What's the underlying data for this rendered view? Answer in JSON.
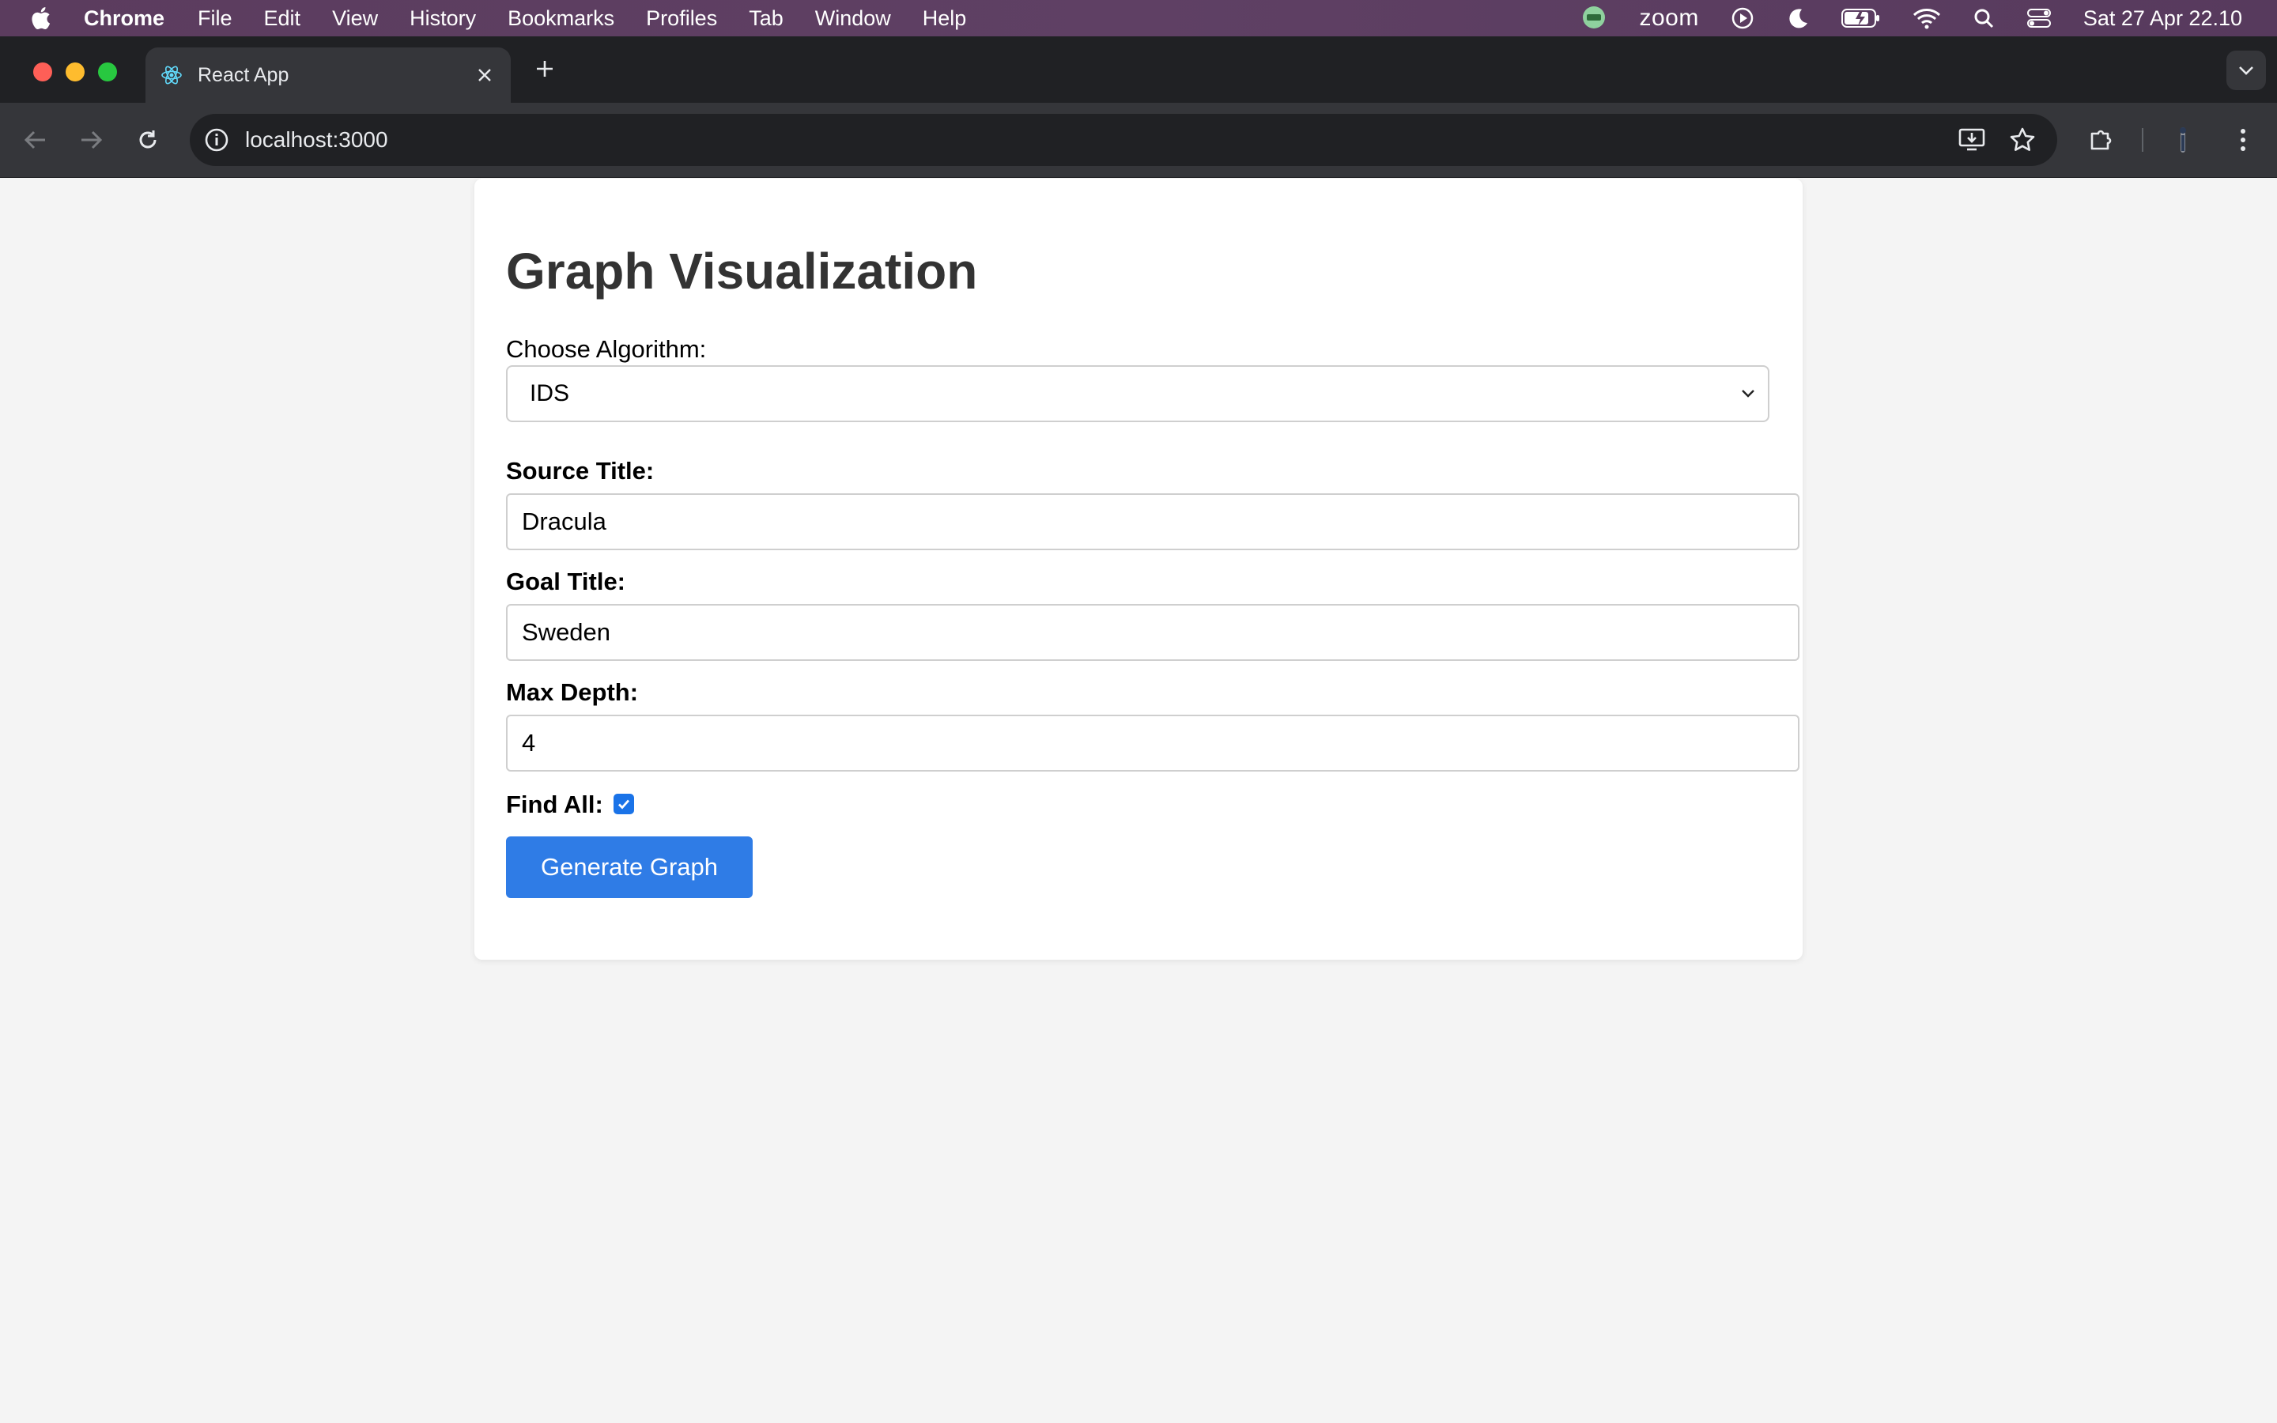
{
  "menubar": {
    "app_name": "Chrome",
    "menus": [
      "File",
      "Edit",
      "View",
      "History",
      "Bookmarks",
      "Profiles",
      "Tab",
      "Window",
      "Help"
    ],
    "zoom_label": "zoom",
    "clock": "Sat 27 Apr  22.10"
  },
  "browser": {
    "tab_title": "React App",
    "url": "localhost:3000"
  },
  "page": {
    "heading": "Graph Visualization",
    "algorithm_label": "Choose Algorithm:",
    "algorithm_value": "IDS",
    "source_label": "Source Title:",
    "source_value": "Dracula",
    "goal_label": "Goal Title:",
    "goal_value": "Sweden",
    "depth_label": "Max Depth:",
    "depth_value": "4",
    "find_all_label": "Find All:",
    "find_all_checked": true,
    "generate_button": "Generate Graph"
  },
  "colors": {
    "menubar": "#5b3c5e",
    "button": "#2f7ce6",
    "checkbox": "#1a73e8",
    "page_bg": "#f4f4f4"
  }
}
